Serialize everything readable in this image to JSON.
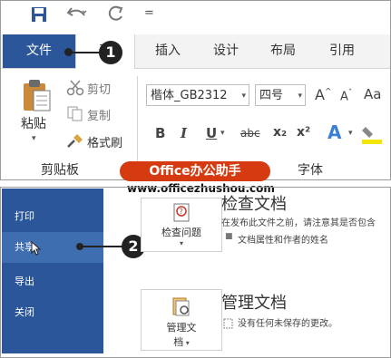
{
  "qat": {
    "save_icon": "save-icon",
    "undo_icon": "undo-icon",
    "redo_icon": "redo-icon",
    "more_icon": "more-icon",
    "more_glyph": "="
  },
  "tabs": {
    "file": "文件",
    "home": "开",
    "insert": "插入",
    "design": "设计",
    "layout": "布局",
    "references": "引用"
  },
  "clipboard": {
    "paste": "粘贴",
    "cut": "剪切",
    "copy": "复制",
    "painter": "格式刷",
    "label": "剪贴板"
  },
  "font": {
    "name": "楷体_GB2312",
    "size": "四号",
    "grow": "A",
    "shrink": "A",
    "aa": "Aa",
    "bold": "B",
    "italic": "I",
    "underline": "U",
    "strike": "abc",
    "sub": "x₂",
    "sup": "x²",
    "effects": "A",
    "label": "字体"
  },
  "callouts": {
    "one": "1",
    "two": "2"
  },
  "watermark": {
    "text": "Office办公助手",
    "url": "www.officezhushou.com"
  },
  "backstage": {
    "items": [
      {
        "label": "打印"
      },
      {
        "label": "共享"
      },
      {
        "label": "导出"
      },
      {
        "label": "关闭"
      }
    ],
    "inspect": {
      "button_label": "检查问题",
      "title": "检查文档",
      "desc": "在发布此文件之前，请注意其是否包含",
      "bullet": "文档属性和作者的姓名"
    },
    "manage": {
      "button_label_1": "管理文",
      "button_label_2": "档",
      "title": "管理文档",
      "desc": "没有任何未保存的更改。"
    }
  },
  "colors": {
    "accent": "#2b579a",
    "watermark": "#d63a10"
  }
}
